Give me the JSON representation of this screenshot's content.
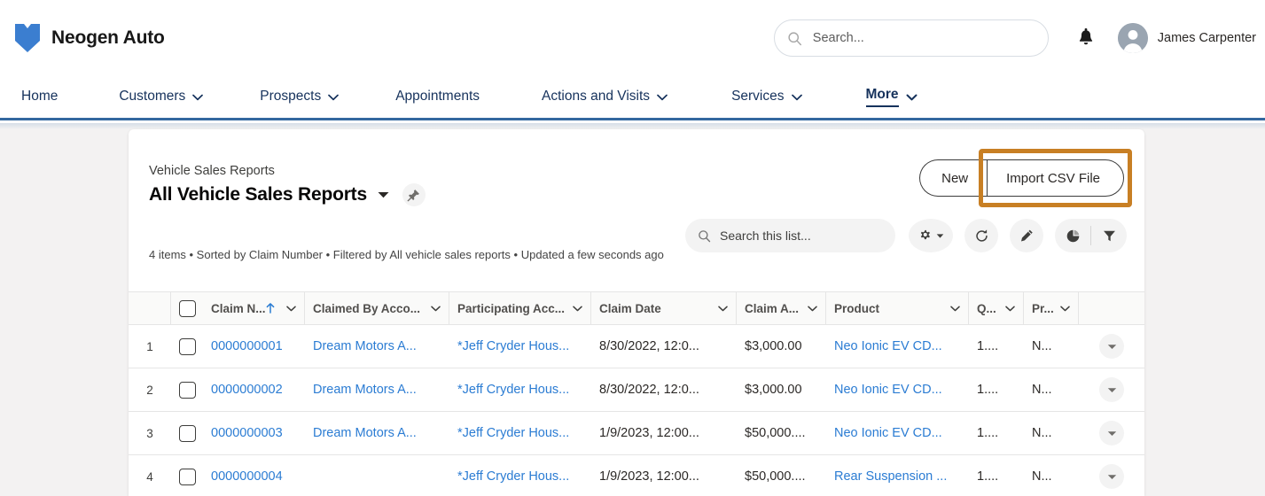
{
  "header": {
    "brand_name": "Neogen Auto",
    "logo_icon": "shield-chevron-logo",
    "search_placeholder": "Search...",
    "search_value": "",
    "search_icon": "search-icon",
    "bell_icon": "notifications-bell-icon",
    "avatar_icon": "user-avatar-icon",
    "user_name": "James Carpenter"
  },
  "nav": {
    "items": [
      {
        "label": "Home",
        "has_caret": false,
        "active": false
      },
      {
        "label": "Customers",
        "has_caret": true,
        "active": false
      },
      {
        "label": "Prospects",
        "has_caret": true,
        "active": false
      },
      {
        "label": "Appointments",
        "has_caret": false,
        "active": false
      },
      {
        "label": "Actions and Visits",
        "has_caret": true,
        "active": false
      },
      {
        "label": "Services",
        "has_caret": true,
        "active": false
      },
      {
        "label": "More",
        "has_caret": true,
        "active": true
      }
    ],
    "caret_icon": "chevron-down-icon"
  },
  "list_view": {
    "object_label": "Vehicle Sales Reports",
    "title": "All Vehicle Sales Reports",
    "title_caret_icon": "chevron-down-icon",
    "pin_icon": "pin-icon",
    "meta": "4 items • Sorted by Claim Number • Filtered by All vehicle sales reports • Updated a few seconds ago",
    "buttons": {
      "new_label": "New",
      "import_label": "Import CSV File",
      "import_highlighted": true,
      "highlight_color": "#c87f24"
    },
    "toolbar": {
      "search_placeholder": "Search this list...",
      "search_value": "",
      "search_icon": "search-icon",
      "settings_icon": "gear-icon",
      "settings_caret_icon": "caret-down-icon",
      "refresh_icon": "refresh-icon",
      "edit_icon": "pencil-icon",
      "chart_icon": "pie-chart-icon",
      "filter_icon": "filter-funnel-icon"
    }
  },
  "table": {
    "select_all_checkbox": "unchecked",
    "sort_icon": "arrow-up-icon",
    "column_chevron_icon": "chevron-down-icon",
    "row_menu_icon": "caret-down-icon",
    "columns": [
      {
        "label": "Claim N...",
        "sorted": true,
        "has_chevron": true
      },
      {
        "label": "Claimed By Acco...",
        "sorted": false,
        "has_chevron": true
      },
      {
        "label": "Participating Acc...",
        "sorted": false,
        "has_chevron": true
      },
      {
        "label": "Claim Date",
        "sorted": false,
        "has_chevron": true
      },
      {
        "label": "Claim A...",
        "sorted": false,
        "has_chevron": true
      },
      {
        "label": "Product",
        "sorted": false,
        "has_chevron": true
      },
      {
        "label": "Q...",
        "sorted": false,
        "has_chevron": true
      },
      {
        "label": "Pr...",
        "sorted": false,
        "has_chevron": true
      }
    ],
    "rows": [
      {
        "index": "1",
        "claim_number": "0000000001",
        "claimed_by_account": "Dream Motors A...",
        "participating_account": "*Jeff Cryder Hous...",
        "claim_date": "8/30/2022, 12:0...",
        "claim_amount": "$3,000.00",
        "product": "Neo Ionic EV CD...",
        "quantity": "1....",
        "pr": "N..."
      },
      {
        "index": "2",
        "claim_number": "0000000002",
        "claimed_by_account": "Dream Motors A...",
        "participating_account": "*Jeff Cryder Hous...",
        "claim_date": "8/30/2022, 12:0...",
        "claim_amount": "$3,000.00",
        "product": "Neo Ionic EV CD...",
        "quantity": "1....",
        "pr": "N..."
      },
      {
        "index": "3",
        "claim_number": "0000000003",
        "claimed_by_account": "Dream Motors A...",
        "participating_account": "*Jeff Cryder Hous...",
        "claim_date": "1/9/2023, 12:00...",
        "claim_amount": "$50,000....",
        "product": "Neo Ionic EV CD...",
        "quantity": "1....",
        "pr": "N..."
      },
      {
        "index": "4",
        "claim_number": "0000000004",
        "claimed_by_account": "",
        "participating_account": "*Jeff Cryder Hous...",
        "claim_date": "1/9/2023, 12:00...",
        "claim_amount": "$50,000....",
        "product": "Rear Suspension ...",
        "quantity": "1....",
        "pr": "N..."
      }
    ]
  },
  "colors": {
    "brand_blue": "#3b7ed0",
    "link_blue": "#2b7cd3",
    "nav_text": "#16325c",
    "nav_border": "#33689f",
    "page_bg": "#f3f2f2",
    "highlight_orange": "#c87f24"
  }
}
